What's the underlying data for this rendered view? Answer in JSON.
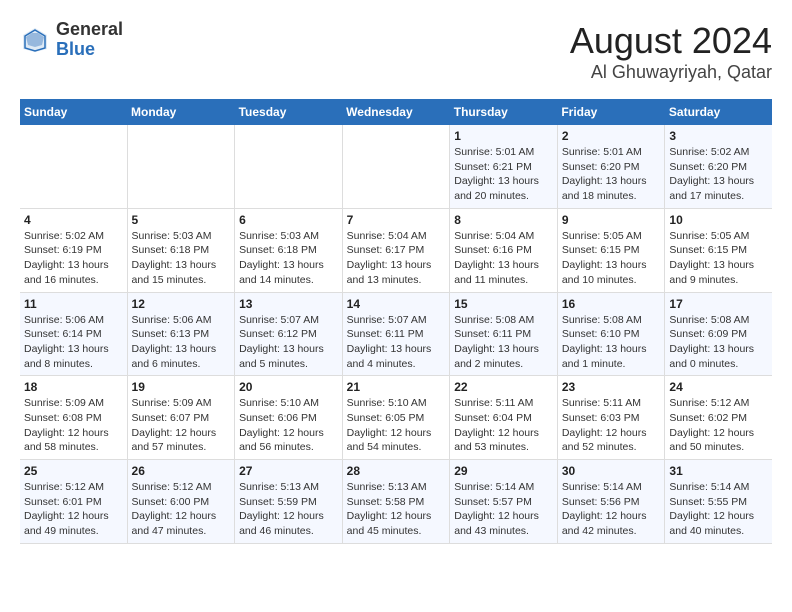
{
  "header": {
    "logo_general": "General",
    "logo_blue": "Blue",
    "main_title": "August 2024",
    "subtitle": "Al Ghuwayriyah, Qatar"
  },
  "weekdays": [
    "Sunday",
    "Monday",
    "Tuesday",
    "Wednesday",
    "Thursday",
    "Friday",
    "Saturday"
  ],
  "weeks": [
    [
      {
        "day": "",
        "info": ""
      },
      {
        "day": "",
        "info": ""
      },
      {
        "day": "",
        "info": ""
      },
      {
        "day": "",
        "info": ""
      },
      {
        "day": "1",
        "info": "Sunrise: 5:01 AM\nSunset: 6:21 PM\nDaylight: 13 hours\nand 20 minutes."
      },
      {
        "day": "2",
        "info": "Sunrise: 5:01 AM\nSunset: 6:20 PM\nDaylight: 13 hours\nand 18 minutes."
      },
      {
        "day": "3",
        "info": "Sunrise: 5:02 AM\nSunset: 6:20 PM\nDaylight: 13 hours\nand 17 minutes."
      }
    ],
    [
      {
        "day": "4",
        "info": "Sunrise: 5:02 AM\nSunset: 6:19 PM\nDaylight: 13 hours\nand 16 minutes."
      },
      {
        "day": "5",
        "info": "Sunrise: 5:03 AM\nSunset: 6:18 PM\nDaylight: 13 hours\nand 15 minutes."
      },
      {
        "day": "6",
        "info": "Sunrise: 5:03 AM\nSunset: 6:18 PM\nDaylight: 13 hours\nand 14 minutes."
      },
      {
        "day": "7",
        "info": "Sunrise: 5:04 AM\nSunset: 6:17 PM\nDaylight: 13 hours\nand 13 minutes."
      },
      {
        "day": "8",
        "info": "Sunrise: 5:04 AM\nSunset: 6:16 PM\nDaylight: 13 hours\nand 11 minutes."
      },
      {
        "day": "9",
        "info": "Sunrise: 5:05 AM\nSunset: 6:15 PM\nDaylight: 13 hours\nand 10 minutes."
      },
      {
        "day": "10",
        "info": "Sunrise: 5:05 AM\nSunset: 6:15 PM\nDaylight: 13 hours\nand 9 minutes."
      }
    ],
    [
      {
        "day": "11",
        "info": "Sunrise: 5:06 AM\nSunset: 6:14 PM\nDaylight: 13 hours\nand 8 minutes."
      },
      {
        "day": "12",
        "info": "Sunrise: 5:06 AM\nSunset: 6:13 PM\nDaylight: 13 hours\nand 6 minutes."
      },
      {
        "day": "13",
        "info": "Sunrise: 5:07 AM\nSunset: 6:12 PM\nDaylight: 13 hours\nand 5 minutes."
      },
      {
        "day": "14",
        "info": "Sunrise: 5:07 AM\nSunset: 6:11 PM\nDaylight: 13 hours\nand 4 minutes."
      },
      {
        "day": "15",
        "info": "Sunrise: 5:08 AM\nSunset: 6:11 PM\nDaylight: 13 hours\nand 2 minutes."
      },
      {
        "day": "16",
        "info": "Sunrise: 5:08 AM\nSunset: 6:10 PM\nDaylight: 13 hours\nand 1 minute."
      },
      {
        "day": "17",
        "info": "Sunrise: 5:08 AM\nSunset: 6:09 PM\nDaylight: 13 hours\nand 0 minutes."
      }
    ],
    [
      {
        "day": "18",
        "info": "Sunrise: 5:09 AM\nSunset: 6:08 PM\nDaylight: 12 hours\nand 58 minutes."
      },
      {
        "day": "19",
        "info": "Sunrise: 5:09 AM\nSunset: 6:07 PM\nDaylight: 12 hours\nand 57 minutes."
      },
      {
        "day": "20",
        "info": "Sunrise: 5:10 AM\nSunset: 6:06 PM\nDaylight: 12 hours\nand 56 minutes."
      },
      {
        "day": "21",
        "info": "Sunrise: 5:10 AM\nSunset: 6:05 PM\nDaylight: 12 hours\nand 54 minutes."
      },
      {
        "day": "22",
        "info": "Sunrise: 5:11 AM\nSunset: 6:04 PM\nDaylight: 12 hours\nand 53 minutes."
      },
      {
        "day": "23",
        "info": "Sunrise: 5:11 AM\nSunset: 6:03 PM\nDaylight: 12 hours\nand 52 minutes."
      },
      {
        "day": "24",
        "info": "Sunrise: 5:12 AM\nSunset: 6:02 PM\nDaylight: 12 hours\nand 50 minutes."
      }
    ],
    [
      {
        "day": "25",
        "info": "Sunrise: 5:12 AM\nSunset: 6:01 PM\nDaylight: 12 hours\nand 49 minutes."
      },
      {
        "day": "26",
        "info": "Sunrise: 5:12 AM\nSunset: 6:00 PM\nDaylight: 12 hours\nand 47 minutes."
      },
      {
        "day": "27",
        "info": "Sunrise: 5:13 AM\nSunset: 5:59 PM\nDaylight: 12 hours\nand 46 minutes."
      },
      {
        "day": "28",
        "info": "Sunrise: 5:13 AM\nSunset: 5:58 PM\nDaylight: 12 hours\nand 45 minutes."
      },
      {
        "day": "29",
        "info": "Sunrise: 5:14 AM\nSunset: 5:57 PM\nDaylight: 12 hours\nand 43 minutes."
      },
      {
        "day": "30",
        "info": "Sunrise: 5:14 AM\nSunset: 5:56 PM\nDaylight: 12 hours\nand 42 minutes."
      },
      {
        "day": "31",
        "info": "Sunrise: 5:14 AM\nSunset: 5:55 PM\nDaylight: 12 hours\nand 40 minutes."
      }
    ]
  ]
}
